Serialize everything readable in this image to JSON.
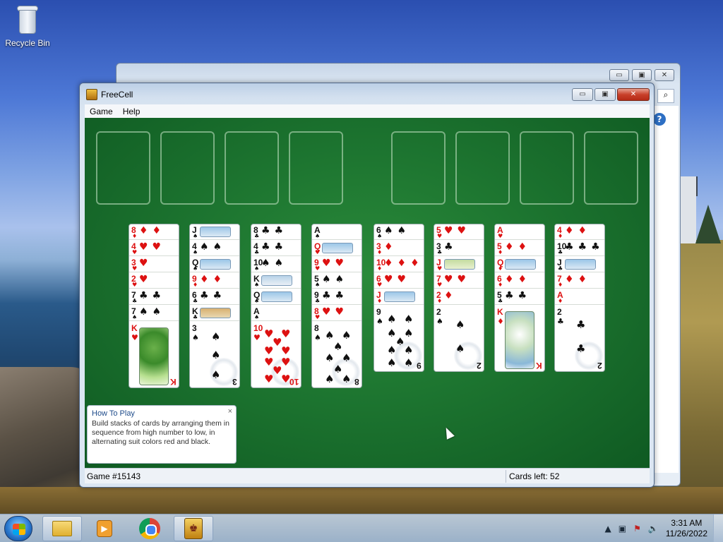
{
  "desktop": {
    "icons": [
      {
        "label": "Recycle Bin"
      }
    ]
  },
  "window": {
    "title": "FreeCell",
    "menu": [
      "Game",
      "Help"
    ],
    "controls": {
      "minimize": "▭",
      "maximize": "▣",
      "close": "✕"
    }
  },
  "board": {
    "free_cells": 4,
    "foundations": 4,
    "columns": [
      {
        "cards": [
          {
            "rank": "8",
            "suit": "♦",
            "color": "red",
            "pips": "♦♦"
          },
          {
            "rank": "4",
            "suit": "♥",
            "color": "red",
            "pips": "♥♥"
          },
          {
            "rank": "3",
            "suit": "♥",
            "color": "red",
            "pips": "♥"
          },
          {
            "rank": "2",
            "suit": "♥",
            "color": "red",
            "pips": "♥"
          },
          {
            "rank": "7",
            "suit": "♣",
            "color": "black",
            "pips": "♣♣"
          },
          {
            "rank": "7",
            "suit": "♠",
            "color": "black",
            "pips": "♠♠"
          }
        ],
        "last": {
          "rank": "K",
          "suit": "♥",
          "color": "red",
          "face": "k-tree"
        }
      },
      {
        "cards": [
          {
            "rank": "J",
            "suit": "♠",
            "color": "black",
            "pic": "sky"
          },
          {
            "rank": "4",
            "suit": "♠",
            "color": "black",
            "pips": "♠♠"
          },
          {
            "rank": "Q",
            "suit": "♠",
            "color": "black",
            "pic": "sky"
          },
          {
            "rank": "9",
            "suit": "♦",
            "color": "red",
            "pips": "♦♦"
          },
          {
            "rank": "6",
            "suit": "♣",
            "color": "black",
            "pips": "♣♣"
          },
          {
            "rank": "K",
            "suit": "♣",
            "color": "black",
            "pic": "tree"
          }
        ],
        "last": {
          "rank": "3",
          "suit": "♠",
          "color": "black",
          "pip_count": 3
        }
      },
      {
        "cards": [
          {
            "rank": "8",
            "suit": "♣",
            "color": "black",
            "pips": "♣♣"
          },
          {
            "rank": "4",
            "suit": "♣",
            "color": "black",
            "pips": "♣♣"
          },
          {
            "rank": "10",
            "suit": "♠",
            "color": "black",
            "pips": "♠♠"
          },
          {
            "rank": "K",
            "suit": "♠",
            "color": "black",
            "pic": "bloss"
          },
          {
            "rank": "Q",
            "suit": "♠",
            "color": "black",
            "pic": "sky"
          },
          {
            "rank": "A",
            "suit": "♠",
            "color": "black",
            "pips": ""
          }
        ],
        "last": {
          "rank": "10",
          "suit": "♥",
          "color": "red",
          "pip_count": 10
        }
      },
      {
        "cards": [
          {
            "rank": "A",
            "suit": "♠",
            "color": "black",
            "pips": ""
          },
          {
            "rank": "Q",
            "suit": "♥",
            "color": "red",
            "pic": "sky"
          },
          {
            "rank": "9",
            "suit": "♥",
            "color": "red",
            "pips": "♥♥"
          },
          {
            "rank": "5",
            "suit": "♠",
            "color": "black",
            "pips": "♠♠"
          },
          {
            "rank": "9",
            "suit": "♣",
            "color": "black",
            "pips": "♣♣"
          },
          {
            "rank": "8",
            "suit": "♥",
            "color": "red",
            "pips": "♥♥"
          }
        ],
        "last": {
          "rank": "8",
          "suit": "♠",
          "color": "black",
          "pip_count": 8
        }
      },
      {
        "cards": [
          {
            "rank": "6",
            "suit": "♠",
            "color": "black",
            "pips": "♠♠"
          },
          {
            "rank": "3",
            "suit": "♦",
            "color": "red",
            "pips": "♦"
          },
          {
            "rank": "10",
            "suit": "♦",
            "color": "red",
            "pips": "♦♦♦"
          },
          {
            "rank": "6",
            "suit": "♥",
            "color": "red",
            "pips": "♥♥"
          },
          {
            "rank": "J",
            "suit": "♦",
            "color": "red",
            "pic": "sky"
          }
        ],
        "last": {
          "rank": "9",
          "suit": "♠",
          "color": "black",
          "pip_count": 9
        }
      },
      {
        "cards": [
          {
            "rank": "5",
            "suit": "♥",
            "color": "red",
            "pips": "♥♥"
          },
          {
            "rank": "3",
            "suit": "♣",
            "color": "black",
            "pips": "♣"
          },
          {
            "rank": "J",
            "suit": "♥",
            "color": "red",
            "pic": "leaf"
          },
          {
            "rank": "7",
            "suit": "♥",
            "color": "red",
            "pips": "♥♥"
          },
          {
            "rank": "2",
            "suit": "♦",
            "color": "red",
            "pips": "♦"
          }
        ],
        "last": {
          "rank": "2",
          "suit": "♠",
          "color": "black",
          "pip_count": 2
        }
      },
      {
        "cards": [
          {
            "rank": "A",
            "suit": "♥",
            "color": "red",
            "pips": ""
          },
          {
            "rank": "5",
            "suit": "♦",
            "color": "red",
            "pips": "♦♦"
          },
          {
            "rank": "Q",
            "suit": "♦",
            "color": "red",
            "pic": "sky"
          },
          {
            "rank": "6",
            "suit": "♦",
            "color": "red",
            "pips": "♦♦"
          },
          {
            "rank": "5",
            "suit": "♣",
            "color": "black",
            "pips": "♣♣"
          }
        ],
        "last": {
          "rank": "K",
          "suit": "♦",
          "color": "red",
          "face": "k-bloss"
        }
      },
      {
        "cards": [
          {
            "rank": "4",
            "suit": "♦",
            "color": "red",
            "pips": "♦♦"
          },
          {
            "rank": "10",
            "suit": "♣",
            "color": "black",
            "pips": "♣♣♣"
          },
          {
            "rank": "J",
            "suit": "♣",
            "color": "black",
            "pic": "sky"
          },
          {
            "rank": "7",
            "suit": "♦",
            "color": "red",
            "pips": "♦♦"
          },
          {
            "rank": "A",
            "suit": "♦",
            "color": "red",
            "pips": ""
          }
        ],
        "last": {
          "rank": "2",
          "suit": "♣",
          "color": "black",
          "pip_count": 2
        }
      }
    ]
  },
  "howto": {
    "title": "How To Play",
    "body": "Build stacks of cards by arranging them in sequence from high number to low, in alternating suit colors red and black.",
    "close": "×"
  },
  "status": {
    "game": "Game #15143",
    "cards_left": "Cards left: 52"
  },
  "taskbar": {
    "clock_time": "3:31 AM",
    "clock_date": "11/26/2022",
    "items": [
      "explorer-icon",
      "media-player-icon",
      "chrome-icon",
      "freecell-icon"
    ]
  }
}
